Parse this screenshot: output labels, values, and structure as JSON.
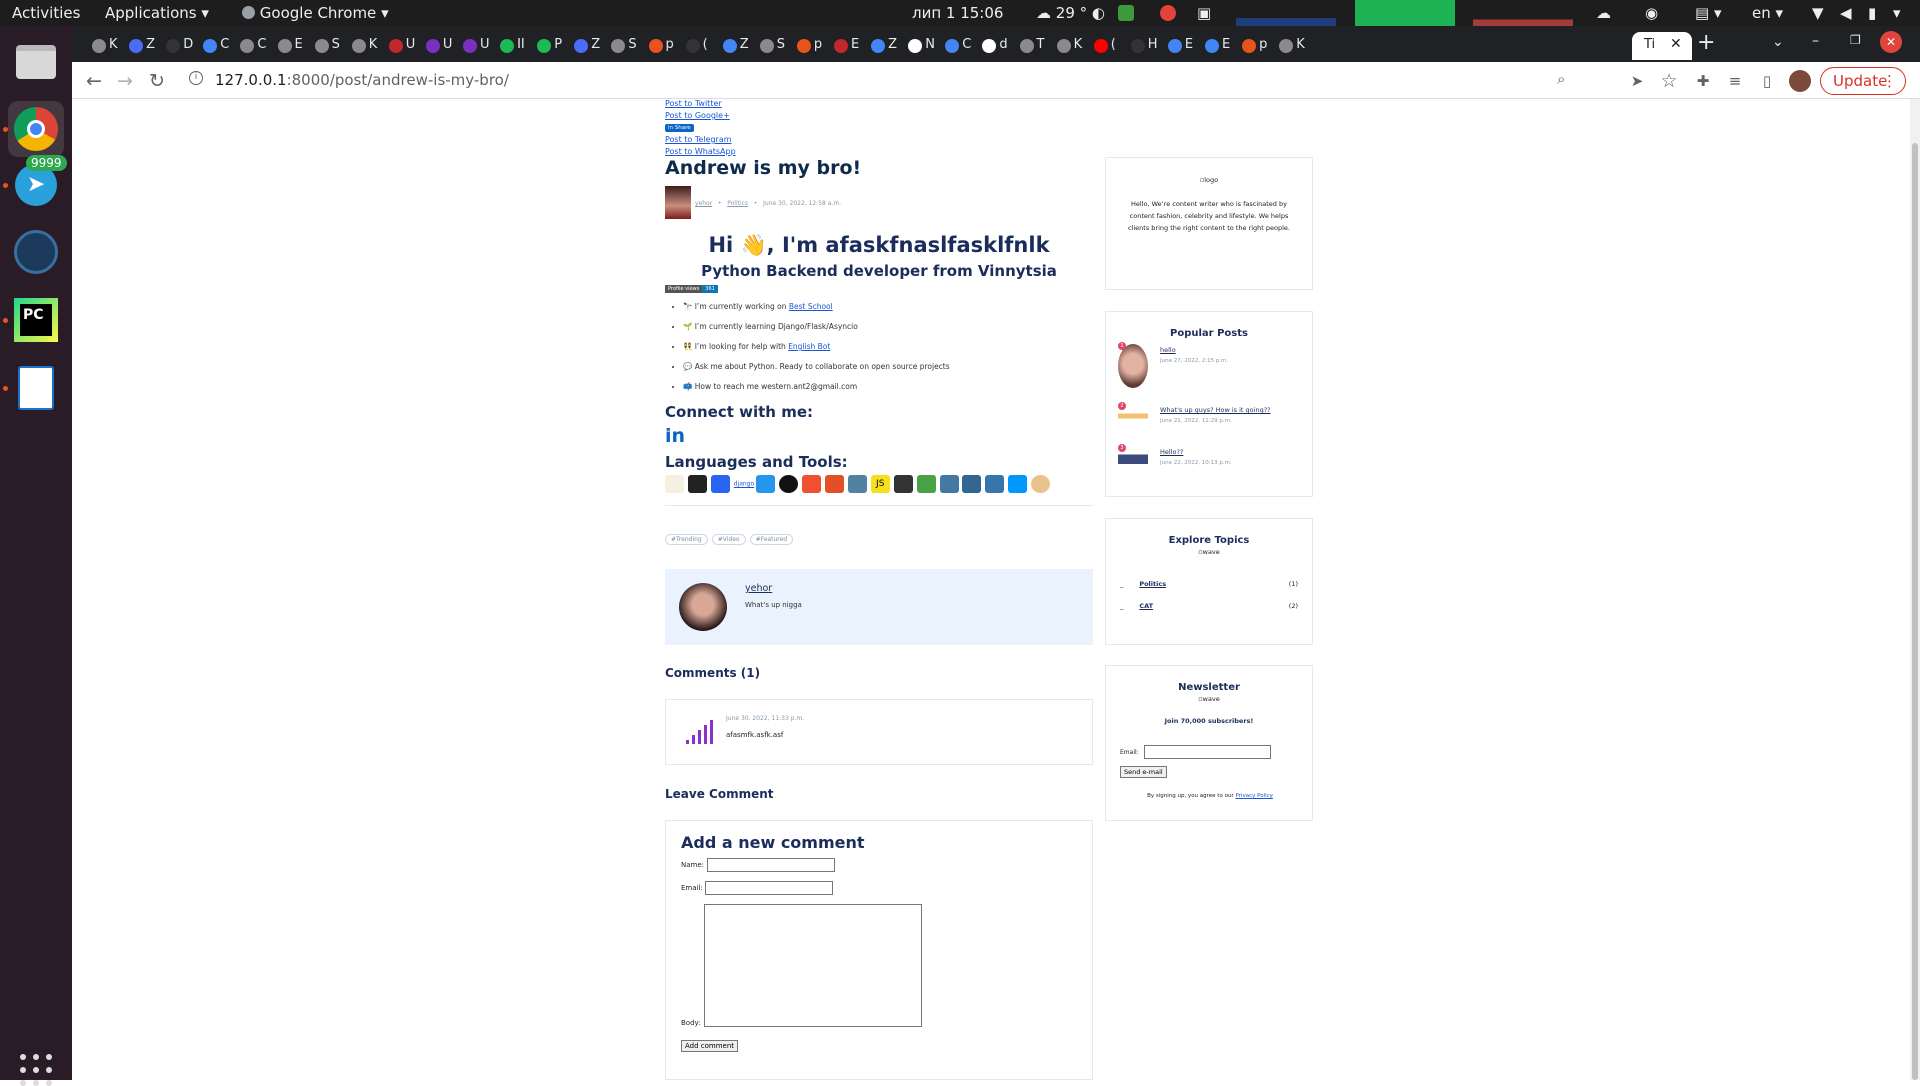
{
  "topbar": {
    "activities": "Activities",
    "applications": "Applications",
    "app_name": "Google Chrome",
    "datetime": "лип 1  15:06",
    "weather": "29 °",
    "language": "en"
  },
  "dock": {
    "telegram_badge": "9999"
  },
  "tabs": [
    {
      "letter": "K"
    },
    {
      "letter": "Z"
    },
    {
      "letter": "D"
    },
    {
      "letter": "C"
    },
    {
      "letter": "C"
    },
    {
      "letter": "E"
    },
    {
      "letter": "S"
    },
    {
      "letter": "K"
    },
    {
      "letter": "U"
    },
    {
      "letter": "U"
    },
    {
      "letter": "U"
    },
    {
      "letter": "II"
    },
    {
      "letter": "P"
    },
    {
      "letter": "Z"
    },
    {
      "letter": "S"
    },
    {
      "letter": "p"
    },
    {
      "letter": "("
    },
    {
      "letter": "Z"
    },
    {
      "letter": "S"
    },
    {
      "letter": "p"
    },
    {
      "letter": "E"
    },
    {
      "letter": "Z"
    },
    {
      "letter": "N"
    },
    {
      "letter": "C"
    },
    {
      "letter": "d"
    },
    {
      "letter": "T"
    },
    {
      "letter": "K"
    },
    {
      "letter": "("
    },
    {
      "letter": "H"
    },
    {
      "letter": "E"
    },
    {
      "letter": "E"
    },
    {
      "letter": "p"
    },
    {
      "letter": "K"
    }
  ],
  "active_tab": {
    "label": "Ti"
  },
  "toolbar": {
    "url_host": "127.0.0.1",
    "url_path": ":8000/post/andrew-is-my-bro/",
    "update_label": "Update"
  },
  "share": {
    "twitter": "Post to Twitter",
    "google": "Post to Google+",
    "linkedin_button": "Share",
    "telegram": "Post to Telegram",
    "whatsapp": "Post to WhatsApp"
  },
  "post": {
    "title": "Andrew is my bro!",
    "author": "yehor",
    "category": "Politics",
    "date": "June 30, 2022, 12:58 a.m."
  },
  "readme": {
    "heading": "Hi 👋, I'm afaskfnaslfasklfnlk",
    "subheading": "Python Backend developer from Vinnytsia",
    "badge_label": "Profile views",
    "badge_count": "361",
    "bullets": [
      {
        "prefix": "🔭 I’m currently working on ",
        "link": "Best School",
        "suffix": ""
      },
      {
        "prefix": "🌱 I’m currently learning Django/Flask/Asyncio",
        "link": "",
        "suffix": ""
      },
      {
        "prefix": "👯 I’m looking for help with ",
        "link": "English Bot",
        "suffix": ""
      },
      {
        "prefix": "💬 Ask me about Python. Ready to collaborate on open source projects",
        "link": "",
        "suffix": ""
      },
      {
        "prefix": "📫 How to reach me western.ant2@gmail.com",
        "link": "",
        "suffix": ""
      }
    ],
    "connect_heading": "Connect with me:",
    "tools_heading": "Languages and Tools:",
    "django_alt": "django",
    "docker_label": "docker",
    "js_label": "JS"
  },
  "tags": [
    "#Trending",
    "#Video",
    "#Featured"
  ],
  "author_box": {
    "name": "yehor",
    "bio": "What's up nigga"
  },
  "comments": {
    "heading": "Comments (1)",
    "items": [
      {
        "date": "June 30, 2022, 11:33 p.m.",
        "body": "afasmfk.asfk.asf"
      }
    ]
  },
  "leave": {
    "heading": "Leave Comment",
    "form_title": "Add a new comment",
    "name_label": "Name:",
    "email_label": "Email:",
    "body_label": "Body:",
    "submit": "Add comment"
  },
  "sidebar": {
    "about": {
      "logo_alt": "logo",
      "text": "Hello, We’re content writer who is fascinated by content fashion, celebrity and lifestyle. We helps clients bring the right content to the right people."
    },
    "popular": {
      "heading": "Popular Posts",
      "items": [
        {
          "title": "hello",
          "date": "June 27, 2022, 2:15 p.m.",
          "rank": "1"
        },
        {
          "title": "What's up guys? How is it going??",
          "date": "June 21, 2022, 11:29 p.m.",
          "rank": "2"
        },
        {
          "title": "Hello??",
          "date": "June 22, 2022, 10:13 p.m.",
          "rank": "3"
        }
      ]
    },
    "topics": {
      "heading": "Explore Topics",
      "wave_alt": "wave",
      "items": [
        {
          "name": "Politics",
          "count": "(1)"
        },
        {
          "name": "CAT",
          "count": "(2)"
        }
      ]
    },
    "newsletter": {
      "heading": "Newsletter",
      "wave_alt": "wave",
      "subscribers": "Join 70,000 subscribers!",
      "email_label": "Email:",
      "send_button": "Send e-mail",
      "disclaimer_prefix": "By signing up, you agree to our ",
      "privacy_link": "Privacy Policy"
    }
  },
  "colors": {
    "accent_link": "#1a55d6",
    "heading": "#1b2d5b",
    "chrome_update": "#d93025",
    "dock_bg": "#2a1c26"
  }
}
